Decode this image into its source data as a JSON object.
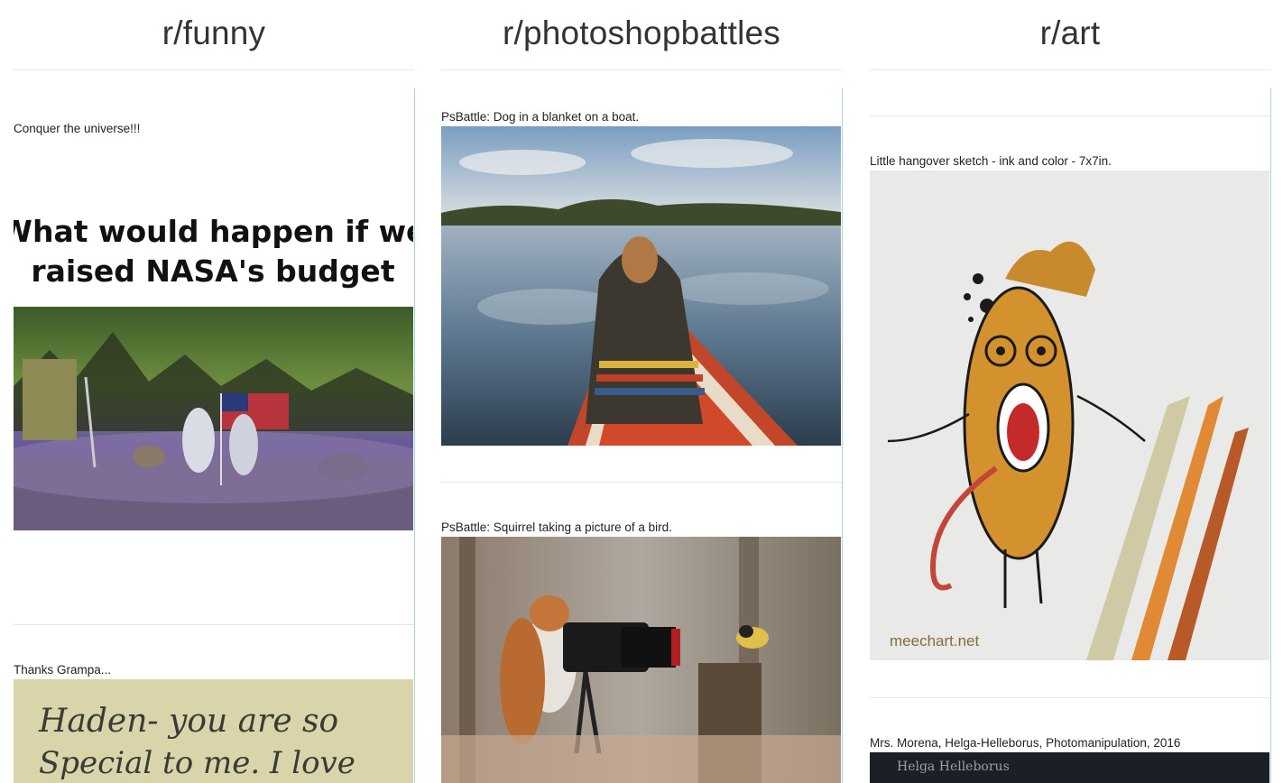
{
  "columns": [
    {
      "subreddit": "r/funny",
      "posts": [
        {
          "title": "Conquer the universe!!!",
          "image_caption_lines": [
            "What would happen if we",
            "raised NASA's budget"
          ]
        },
        {
          "title": "Thanks Grampa...",
          "handwriting_lines": [
            "Haden-  you are so",
            "Special  to  me.  I  love"
          ]
        }
      ]
    },
    {
      "subreddit": "r/photoshopbattles",
      "posts": [
        {
          "title": "PsBattle: Dog in a blanket on a boat."
        },
        {
          "title": "PsBattle: Squirrel taking a picture of a bird."
        }
      ]
    },
    {
      "subreddit": "r/art",
      "posts": [
        {
          "title": "Little hangover sketch - ink and color - 7x7in.",
          "watermark": "meechart.net"
        },
        {
          "title": "Mrs. Morena, Helga-Helleborus, Photomanipulation, 2016",
          "watermark": "Helga Helleborus"
        }
      ]
    }
  ],
  "colors": {
    "divider": "#e6e6e6",
    "feed_border": "#a9d4de",
    "heading": "#333333"
  }
}
